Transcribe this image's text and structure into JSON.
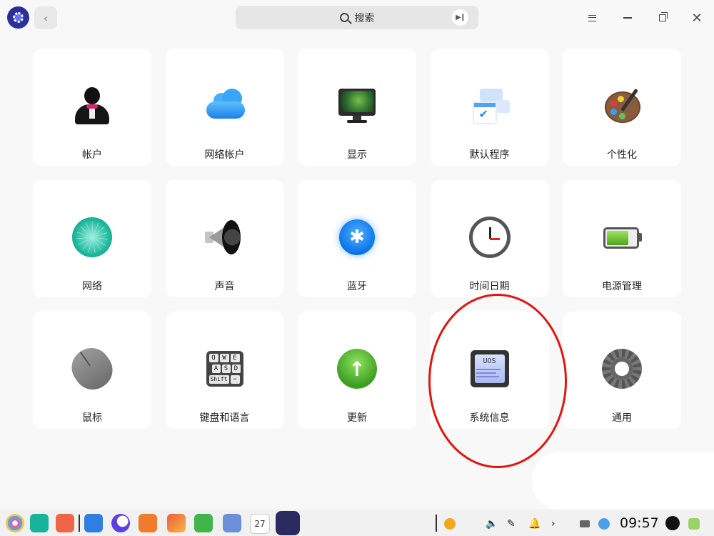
{
  "header": {
    "search_placeholder": "搜索"
  },
  "tiles": [
    {
      "label": "帐户",
      "icon": "account-icon"
    },
    {
      "label": "网络帐户",
      "icon": "cloud-account-icon"
    },
    {
      "label": "显示",
      "icon": "display-icon"
    },
    {
      "label": "默认程序",
      "icon": "default-apps-icon"
    },
    {
      "label": "个性化",
      "icon": "personalization-icon"
    },
    {
      "label": "网络",
      "icon": "network-icon"
    },
    {
      "label": "声音",
      "icon": "sound-icon"
    },
    {
      "label": "蓝牙",
      "icon": "bluetooth-icon"
    },
    {
      "label": "时间日期",
      "icon": "clock-icon"
    },
    {
      "label": "电源管理",
      "icon": "battery-icon"
    },
    {
      "label": "鼠标",
      "icon": "mouse-icon"
    },
    {
      "label": "键盘和语言",
      "icon": "keyboard-icon"
    },
    {
      "label": "更新",
      "icon": "update-icon"
    },
    {
      "label": "系统信息",
      "icon": "system-info-icon"
    },
    {
      "label": "通用",
      "icon": "gear-icon"
    }
  ],
  "icon_text": {
    "sysinfo_chip": "UOS",
    "keys": [
      "Q",
      "W",
      "E",
      "A",
      "S",
      "D",
      "Shift",
      "−"
    ],
    "calendar_day": "27",
    "bluetooth_glyph": "✱",
    "update_glyph": "↑"
  },
  "taskbar": {
    "time": "09:57"
  },
  "colors": {
    "annotation": "#e3140f",
    "accent_blue": "#0a73e8"
  }
}
